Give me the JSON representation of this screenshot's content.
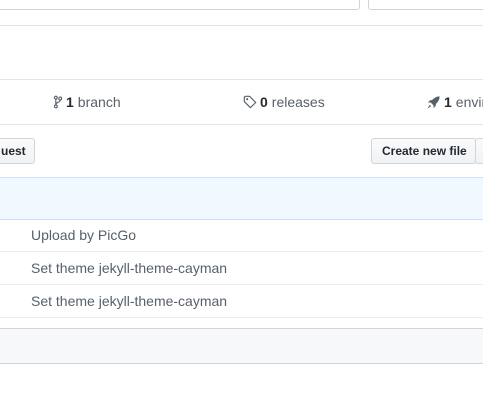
{
  "summary": {
    "branch": {
      "count": "1",
      "label": "branch",
      "icon": "git-branch-icon"
    },
    "releases": {
      "count": "0",
      "label": "releases",
      "icon": "tag-icon"
    },
    "environments": {
      "count": "1",
      "label": "envir",
      "icon": "rocket-icon"
    }
  },
  "toolbar": {
    "pull_request_label": "uest",
    "create_file_label": "Create new file"
  },
  "files": [
    {
      "commit_message": "Upload by PicGo"
    },
    {
      "commit_message": "Set theme jekyll-theme-cayman"
    },
    {
      "commit_message": "Set theme jekyll-theme-cayman"
    }
  ],
  "colors": {
    "border": "#e1e4e8",
    "commit_bar_bg": "#f1f8ff",
    "text_muted": "#586069"
  }
}
